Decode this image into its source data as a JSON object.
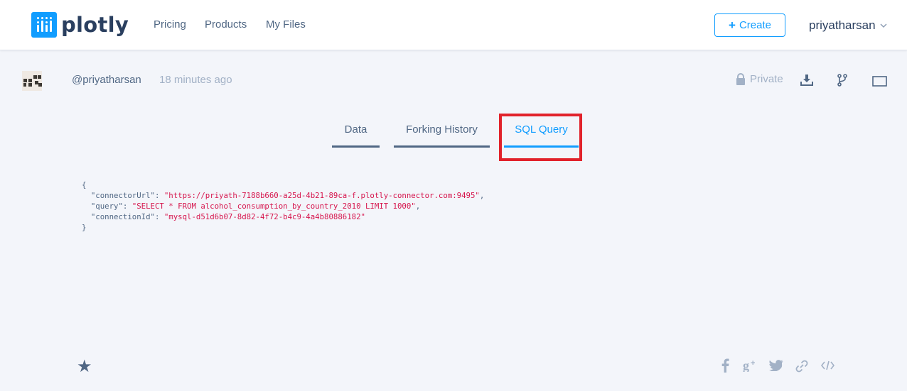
{
  "nav": {
    "brand": "plotly",
    "links": [
      "Pricing",
      "Products",
      "My Files"
    ],
    "create_label": "Create",
    "username": "priyatharsan"
  },
  "meta": {
    "handle": "@priyatharsan",
    "timestamp": "18 minutes ago",
    "privacy": "Private"
  },
  "tabs": [
    {
      "label": "Data"
    },
    {
      "label": "Forking History"
    },
    {
      "label": "SQL Query",
      "active": true
    }
  ],
  "query": {
    "open_brace": "{",
    "close_brace": "}",
    "entries": [
      {
        "key": "\"connectorUrl\"",
        "value": "\"https://priyath-7188b660-a25d-4b21-89ca-f.plotly-connector.com:9495\"",
        "sep": ","
      },
      {
        "key": "\"query\"",
        "value": "\"SELECT * FROM alcohol_consumption_by_country_2010 LIMIT 1000\"",
        "sep": ","
      },
      {
        "key": "\"connectionId\"",
        "value": "\"mysql-d51d6b07-8d82-4f72-b4c9-4a4b80886182\"",
        "sep": ""
      }
    ]
  },
  "footer": {
    "star_icon": "star-icon",
    "share_icons": [
      "facebook-icon",
      "google-plus-icon",
      "twitter-icon",
      "link-icon",
      "embed-code-icon"
    ]
  },
  "colors": {
    "accent": "#119dff",
    "highlight": "#e1222b",
    "string": "#d6154d"
  }
}
